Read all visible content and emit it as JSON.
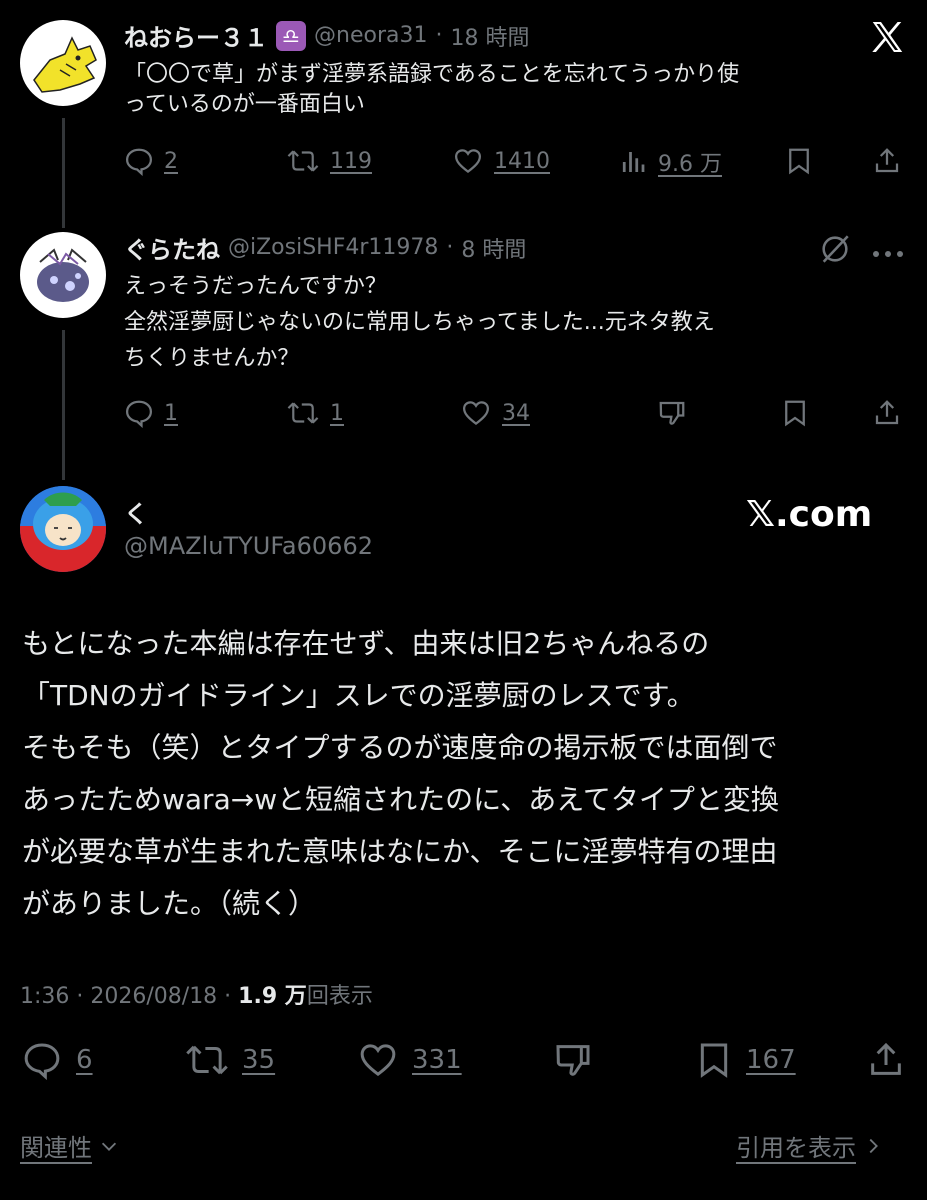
{
  "tweet1": {
    "name": "ねおらー３１",
    "badge": "♎",
    "handle": "@neora31",
    "sep": "·",
    "time": "18 時間",
    "text_lines": [
      "「〇〇で草」がまず淫夢系語録であることを忘れてうっかり使",
      "っているのが一番面白い"
    ],
    "replies": "2",
    "retweets": "119",
    "likes": "1410",
    "views": "9.6 万"
  },
  "tweet2": {
    "name": "ぐらたね",
    "handle": "@iZosiSHF4r11978",
    "sep": "·",
    "time": "8 時間",
    "text_lines": [
      "えっそうだったんですか？",
      "全然淫夢厨じゃないのに常用しちゃってました...元ネタ教え",
      "ちくりませんか？"
    ],
    "replies": "1",
    "retweets": "1",
    "likes": "34"
  },
  "main": {
    "name": "く",
    "handle": "@MAZluTYUFa60662",
    "watermark": "𝕏.com",
    "text_lines": [
      "もとになった本編は存在せず、由来は旧2ちゃんねるの",
      "「TDNのガイドライン」スレでの淫夢厨のレスです。",
      "そもそも（笑）とタイプするのが速度命の掲示板では面倒で",
      "あったためwara→wと短縮されたのに、あえてタイプと変換",
      "が必要な草が生まれた意味はなにか、そこに淫夢特有の理由",
      "がありました。（続く）"
    ],
    "time": "1:36 · 2026/08/18 · ",
    "views_count": "1.9 万",
    "views_label": "回表示",
    "replies": "6",
    "retweets": "35",
    "likes": "331",
    "bookmarks": "167"
  },
  "footer": {
    "related": "関連性",
    "quotes": "引用を表示"
  },
  "colors": {
    "background": "#000000",
    "text": "#e7e9ea",
    "muted": "#71767b"
  },
  "icons": [
    "x-logo-icon",
    "reply-icon",
    "retweet-icon",
    "like-icon",
    "views-icon",
    "bookmark-icon",
    "share-icon",
    "grok-icon",
    "more-icon",
    "dislike-icon",
    "chevron-down-icon",
    "chevron-right-icon"
  ]
}
